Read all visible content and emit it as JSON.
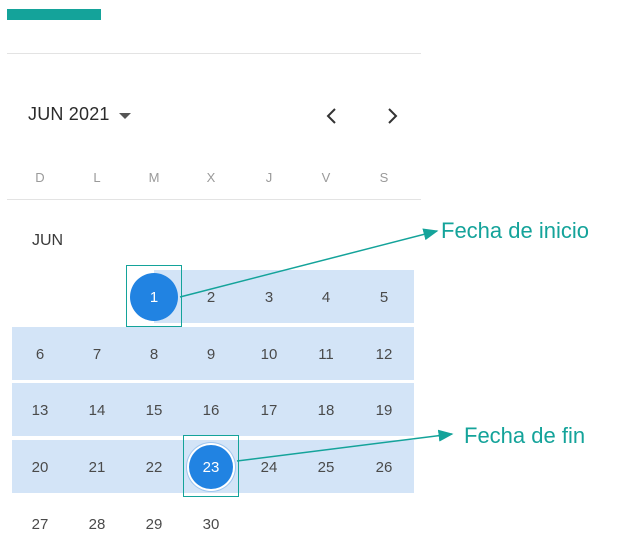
{
  "header": {
    "month_label": "JUN 2021",
    "prev_icon": "chevron-left-icon",
    "next_icon": "chevron-right-icon",
    "dropdown_icon": "caret-down-icon"
  },
  "weekdays": [
    "D",
    "L",
    "M",
    "X",
    "J",
    "V",
    "S"
  ],
  "calendar": {
    "month_heading": "JUN",
    "weeks": [
      [
        "",
        "",
        "1",
        "2",
        "3",
        "4",
        "5"
      ],
      [
        "6",
        "7",
        "8",
        "9",
        "10",
        "11",
        "12"
      ],
      [
        "13",
        "14",
        "15",
        "16",
        "17",
        "18",
        "19"
      ],
      [
        "20",
        "21",
        "22",
        "23",
        "24",
        "25",
        "26"
      ],
      [
        "27",
        "28",
        "29",
        "30",
        "",
        "",
        ""
      ]
    ],
    "range_start": "1",
    "range_end": "23"
  },
  "annotations": {
    "start_label": "Fecha de inicio",
    "end_label": "Fecha de fin"
  },
  "colors": {
    "accent": "#14a39a",
    "selected": "#2183e2",
    "range": "#d3e4f7"
  }
}
